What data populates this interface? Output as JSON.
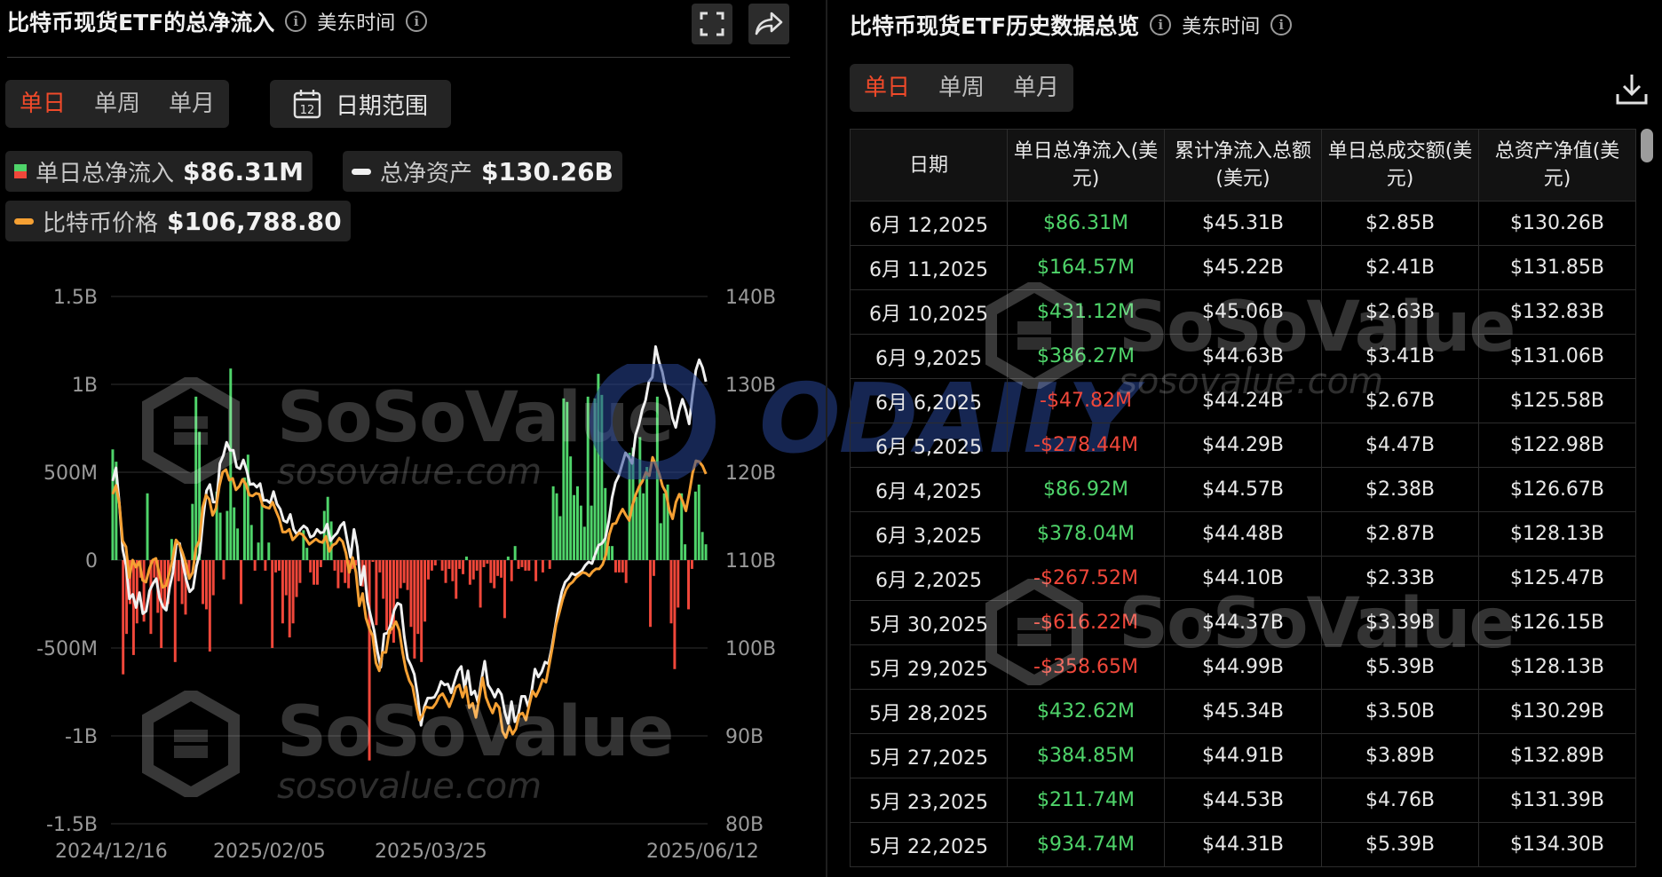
{
  "left": {
    "title": "比特币现货ETF的总净流入",
    "subtitle": "美东时间",
    "tabs": [
      "单日",
      "单周",
      "单月"
    ],
    "active_tab": 0,
    "date_range_label": "日期范围",
    "calendar_day": "12",
    "legend": [
      {
        "label": "单日总净流入",
        "value": "$86.31M"
      },
      {
        "label": "总净资产",
        "value": "$130.26B"
      },
      {
        "label": "比特币价格",
        "value": "$106,788.80"
      }
    ]
  },
  "right": {
    "title": "比特币现货ETF历史数据总览",
    "subtitle": "美东时间",
    "tabs": [
      "单日",
      "单周",
      "单月"
    ],
    "active_tab": 0,
    "headers": [
      "日期",
      "单日总净流入(美元)",
      "累计净流入总额(美元)",
      "单日总成交额(美元)",
      "总资产净值(美元)"
    ],
    "rows": [
      [
        "6月 12,2025",
        "$86.31M",
        "$45.31B",
        "$2.85B",
        "$130.26B"
      ],
      [
        "6月 11,2025",
        "$164.57M",
        "$45.22B",
        "$2.41B",
        "$131.85B"
      ],
      [
        "6月 10,2025",
        "$431.12M",
        "$45.06B",
        "$2.63B",
        "$132.83B"
      ],
      [
        "6月 9,2025",
        "$386.27M",
        "$44.63B",
        "$3.41B",
        "$131.06B"
      ],
      [
        "6月 6,2025",
        "-$47.82M",
        "$44.24B",
        "$2.67B",
        "$125.58B"
      ],
      [
        "6月 5,2025",
        "-$278.44M",
        "$44.29B",
        "$4.47B",
        "$122.98B"
      ],
      [
        "6月 4,2025",
        "$86.92M",
        "$44.57B",
        "$2.38B",
        "$126.67B"
      ],
      [
        "6月 3,2025",
        "$378.04M",
        "$44.48B",
        "$2.87B",
        "$128.13B"
      ],
      [
        "6月 2,2025",
        "-$267.52M",
        "$44.10B",
        "$2.33B",
        "$125.47B"
      ],
      [
        "5月 30,2025",
        "-$616.22M",
        "$44.37B",
        "$3.39B",
        "$126.15B"
      ],
      [
        "5月 29,2025",
        "-$358.65M",
        "$44.99B",
        "$5.39B",
        "$128.13B"
      ],
      [
        "5月 28,2025",
        "$432.62M",
        "$45.34B",
        "$3.50B",
        "$130.29B"
      ],
      [
        "5月 27,2025",
        "$384.85M",
        "$44.91B",
        "$3.89B",
        "$132.89B"
      ],
      [
        "5月 23,2025",
        "$211.74M",
        "$44.53B",
        "$4.76B",
        "$131.39B"
      ],
      [
        "5月 22,2025",
        "$934.74M",
        "$44.31B",
        "$5.39B",
        "$134.30B"
      ]
    ]
  },
  "watermarks": {
    "brand": "SoSoValue",
    "url": "sosovalue.com",
    "overlay": "ODAILY"
  },
  "colors": {
    "accent": "#f04a2a",
    "inflow": "#4fd46a",
    "outflow": "#f0473a",
    "assets_line": "#f0f0f0",
    "price_line": "#f5a033"
  },
  "chart_data": {
    "type": "bar+line",
    "x_start": "2024/12/16",
    "x_end": "2025/06/12",
    "x_tick_labels": [
      "2024/12/16",
      "2025/02/05",
      "2025/03/25",
      "2025/06/12"
    ],
    "y_left": {
      "min": -1500000000,
      "max": 1500000000,
      "ticks": [
        "1.5B",
        "1B",
        "500M",
        "0",
        "-500M",
        "-1B",
        "-1.5B"
      ]
    },
    "y_right": {
      "min": 80000000000,
      "max": 140000000000,
      "ticks": [
        "140B",
        "130B",
        "120B",
        "110B",
        "100B",
        "90B",
        "80B"
      ]
    },
    "grid": true,
    "series": [
      {
        "name": "单日总净流入",
        "type": "bar",
        "axis": "left",
        "unit": "USD millions",
        "values": [
          630,
          560,
          0,
          -650,
          -420,
          -250,
          -540,
          -360,
          -100,
          -350,
          380,
          -420,
          -100,
          -300,
          -500,
          -280,
          -250,
          120,
          -580,
          -120,
          -250,
          -310,
          -100,
          320,
          930,
          730,
          -250,
          -280,
          -520,
          -200,
          390,
          270,
          -110,
          280,
          1090,
          300,
          180,
          -250,
          470,
          600,
          200,
          -60,
          100,
          370,
          -60,
          100,
          -500,
          -70,
          -60,
          -360,
          -200,
          -440,
          -360,
          -210,
          -130,
          170,
          70,
          -70,
          -140,
          -140,
          -40,
          280,
          360,
          220,
          -60,
          -160,
          -70,
          -130,
          -160,
          -50,
          -30,
          -30,
          -150,
          -170,
          -1140,
          -10,
          -370,
          -70,
          -220,
          -400,
          -420,
          -470,
          -220,
          -160,
          -130,
          -170,
          -380,
          -560,
          -420,
          -580,
          -350,
          -110,
          -60,
          -30,
          0,
          -60,
          -130,
          -50,
          -120,
          -220,
          -50,
          -80,
          20,
          -140,
          -110,
          -60,
          -270,
          -40,
          -20,
          -130,
          -160,
          -90,
          -100,
          -330,
          20,
          -120,
          80,
          -50,
          -40,
          -60,
          -60,
          0,
          -120,
          0,
          -70,
          0,
          -50,
          420,
          380,
          250,
          920,
          900,
          590,
          370,
          420,
          310,
          190,
          930,
          310,
          920,
          1060,
          940,
          410,
          80,
          80,
          -70,
          -70,
          -70,
          -130,
          610,
          640,
          360,
          700,
          380,
          530,
          -380,
          -90,
          930,
          210,
          380,
          430,
          -360,
          -620,
          -270,
          380,
          90,
          -280,
          -50,
          390,
          430,
          160,
          90
        ]
      },
      {
        "name": "总净资产",
        "type": "line",
        "axis": "right",
        "unit": "USD billions",
        "values": [
          119,
          120.5,
          116.4,
          111.2,
          109.4,
          105.6,
          106.1,
          104.6,
          106.3,
          103.9,
          104.2,
          106.5,
          107.3,
          107.9,
          105.7,
          104.7,
          104.3,
          106.9,
          108.6,
          111.9,
          111.9,
          109.5,
          107.7,
          106.4,
          106.8,
          109.3,
          110.8,
          114.8,
          117.9,
          118.6,
          116.6,
          116.6,
          121,
          121.9,
          123.4,
          122.5,
          122.5,
          120.6,
          120.4,
          121.4,
          120.2,
          118.6,
          118.7,
          118.3,
          118.7,
          116.8,
          116.8,
          116.5,
          117.8,
          116.4,
          115.8,
          114.5,
          114.3,
          115.2,
          113.5,
          112.9,
          113.5,
          113.9,
          113.6,
          112.6,
          112.8,
          113.5,
          113.1,
          113.2,
          114.1,
          112.2,
          112.7,
          113.1,
          113.9,
          114.3,
          112.2,
          110.3,
          113.5,
          111.5,
          107.2,
          109.3,
          105.3,
          103.6,
          102,
          99.6,
          97.8,
          101.6,
          101.7,
          102.7,
          104.3,
          105.1,
          104.9,
          101.3,
          98.8,
          98,
          97,
          94.6,
          91.2,
          93.3,
          94.3,
          94.3,
          94.4,
          95.1,
          96.2,
          95.8,
          95.9,
          94.9,
          96.2,
          97.4,
          97.9,
          95.4,
          97.4,
          94.7,
          95.1,
          93.8,
          96.3,
          98.5,
          95.8,
          95.2,
          94.4,
          95.3,
          94.7,
          92.7,
          91.4,
          93.9,
          91.6,
          92.4,
          94.5,
          94.5,
          93.3,
          95.1,
          97.6,
          96.7,
          97.3,
          98.4,
          98.2,
          100,
          102.3,
          104.6,
          106.4,
          107.5,
          107.9,
          108.5,
          108.3,
          108.5,
          108.8,
          109.4,
          109.8,
          109.6,
          110.7,
          111.7,
          111.9,
          112.5,
          114.4,
          117.1,
          118.8,
          119.6,
          120.9,
          122.2,
          121.7,
          121,
          124.2,
          125.4,
          127.1,
          128.2,
          130.3,
          130.8,
          134.3,
          132.6,
          131.4,
          129.5,
          128.4,
          126.2,
          125.1,
          127,
          128.3,
          127.1,
          125.5,
          128.8,
          131.6,
          132.8,
          131.9,
          130.3
        ]
      },
      {
        "name": "比特币价格",
        "type": "line",
        "axis": "right",
        "unit": "USD, plotted on right axis scale",
        "values": [
          117.5,
          118.5,
          116.5,
          112.2,
          111.5,
          108,
          110,
          109.2,
          109.8,
          107.7,
          107.5,
          109,
          110,
          110.2,
          108.4,
          106.9,
          107.1,
          108.5,
          110.2,
          112.3,
          111.8,
          110.8,
          109.6,
          107.9,
          108.6,
          111.4,
          112.2,
          116,
          117.4,
          116.9,
          115.1,
          115.9,
          118.4,
          120,
          120.3,
          119.1,
          119.3,
          118,
          118.4,
          119.2,
          118.6,
          117.4,
          117.3,
          117.6,
          117.5,
          116.2,
          116,
          115.9,
          116.6,
          115.6,
          114.7,
          113.2,
          113.2,
          113.5,
          112.3,
          112.7,
          113.1,
          112.9,
          112.4,
          111.8,
          112.1,
          112.4,
          112.1,
          112,
          112.7,
          111,
          111.7,
          111.9,
          112.5,
          112.1,
          110.8,
          108.6,
          110.3,
          108.6,
          104.8,
          106.2,
          103.4,
          102.2,
          101.4,
          98.3,
          97.4,
          99.5,
          99.5,
          101.9,
          102.3,
          103,
          102,
          99.5,
          97.5,
          96.3,
          95.6,
          93.6,
          91.8,
          92.4,
          93.3,
          93.2,
          93.2,
          93.7,
          94.5,
          94.8,
          94.1,
          93.3,
          94.3,
          95.5,
          95.8,
          94.4,
          95.6,
          93.2,
          93.7,
          92.1,
          94.3,
          96.6,
          94.4,
          93.4,
          92.6,
          93.7,
          93.2,
          90.5,
          89.8,
          91.1,
          90.2,
          90.8,
          92.4,
          92.6,
          91.8,
          93.5,
          95.1,
          94.5,
          95.3,
          96.4,
          96.1,
          98.1,
          100.2,
          102.6,
          104,
          105.5,
          106.6,
          107.2,
          107.5,
          108,
          108.3,
          108.6,
          108.5,
          108.2,
          108.7,
          109,
          109,
          109.5,
          110.6,
          112.9,
          114.1,
          114.2,
          115.1,
          115.8,
          115.1,
          114.5,
          116.3,
          117.5,
          118.4,
          119,
          120,
          119.6,
          121.7,
          120.8,
          119.8,
          118.4,
          117.7,
          115.7,
          114.7,
          116.6,
          117.5,
          116.7,
          115.6,
          117.6,
          119.9,
          121.3,
          121.2,
          120.7,
          119.8
        ]
      }
    ]
  }
}
